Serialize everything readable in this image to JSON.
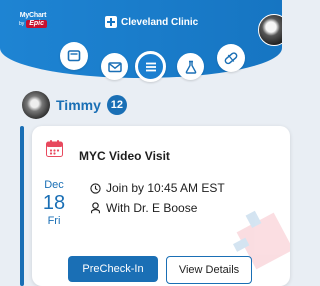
{
  "header": {
    "mychart_label": "MyChart",
    "by_label": "by",
    "epic_label": "Epic",
    "clinic_name": "Cleveland Clinic"
  },
  "nav_icons": [
    "home-icon",
    "mail-icon",
    "menu-icon",
    "test-results-icon",
    "medications-icon"
  ],
  "person": {
    "name": "Timmy",
    "badge": "12"
  },
  "visit": {
    "title": "MYC Video Visit",
    "month": "Dec",
    "day": "18",
    "weekday": "Fri",
    "join_text": "Join by 10:45 AM EST",
    "provider_text": "With Dr. E Boose",
    "precheckin_label": "PreCheck-In",
    "details_label": "View Details"
  },
  "colors": {
    "brand_blue": "#1675c2",
    "text_blue": "#1a6fb5",
    "calendar_red": "#e8495e"
  }
}
